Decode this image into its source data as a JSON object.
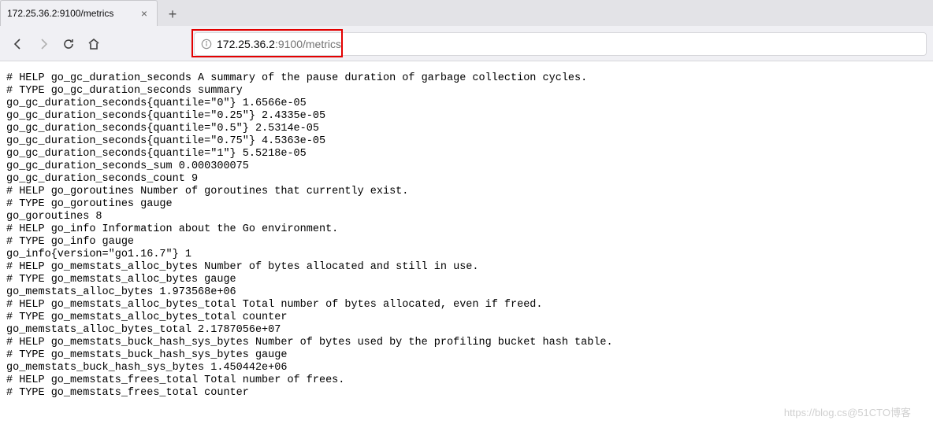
{
  "tab": {
    "title": "172.25.36.2:9100/metrics"
  },
  "url": {
    "host": "172.25.36.2",
    "port_path": ":9100/metrics"
  },
  "metrics_lines": [
    "# HELP go_gc_duration_seconds A summary of the pause duration of garbage collection cycles.",
    "# TYPE go_gc_duration_seconds summary",
    "go_gc_duration_seconds{quantile=\"0\"} 1.6566e-05",
    "go_gc_duration_seconds{quantile=\"0.25\"} 2.4335e-05",
    "go_gc_duration_seconds{quantile=\"0.5\"} 2.5314e-05",
    "go_gc_duration_seconds{quantile=\"0.75\"} 4.5363e-05",
    "go_gc_duration_seconds{quantile=\"1\"} 5.5218e-05",
    "go_gc_duration_seconds_sum 0.000300075",
    "go_gc_duration_seconds_count 9",
    "# HELP go_goroutines Number of goroutines that currently exist.",
    "# TYPE go_goroutines gauge",
    "go_goroutines 8",
    "# HELP go_info Information about the Go environment.",
    "# TYPE go_info gauge",
    "go_info{version=\"go1.16.7\"} 1",
    "# HELP go_memstats_alloc_bytes Number of bytes allocated and still in use.",
    "# TYPE go_memstats_alloc_bytes gauge",
    "go_memstats_alloc_bytes 1.973568e+06",
    "# HELP go_memstats_alloc_bytes_total Total number of bytes allocated, even if freed.",
    "# TYPE go_memstats_alloc_bytes_total counter",
    "go_memstats_alloc_bytes_total 2.1787056e+07",
    "# HELP go_memstats_buck_hash_sys_bytes Number of bytes used by the profiling bucket hash table.",
    "# TYPE go_memstats_buck_hash_sys_bytes gauge",
    "go_memstats_buck_hash_sys_bytes 1.450442e+06",
    "# HELP go_memstats_frees_total Total number of frees.",
    "# TYPE go_memstats_frees_total counter"
  ],
  "watermark": "https://blog.cs@51CTO博客"
}
